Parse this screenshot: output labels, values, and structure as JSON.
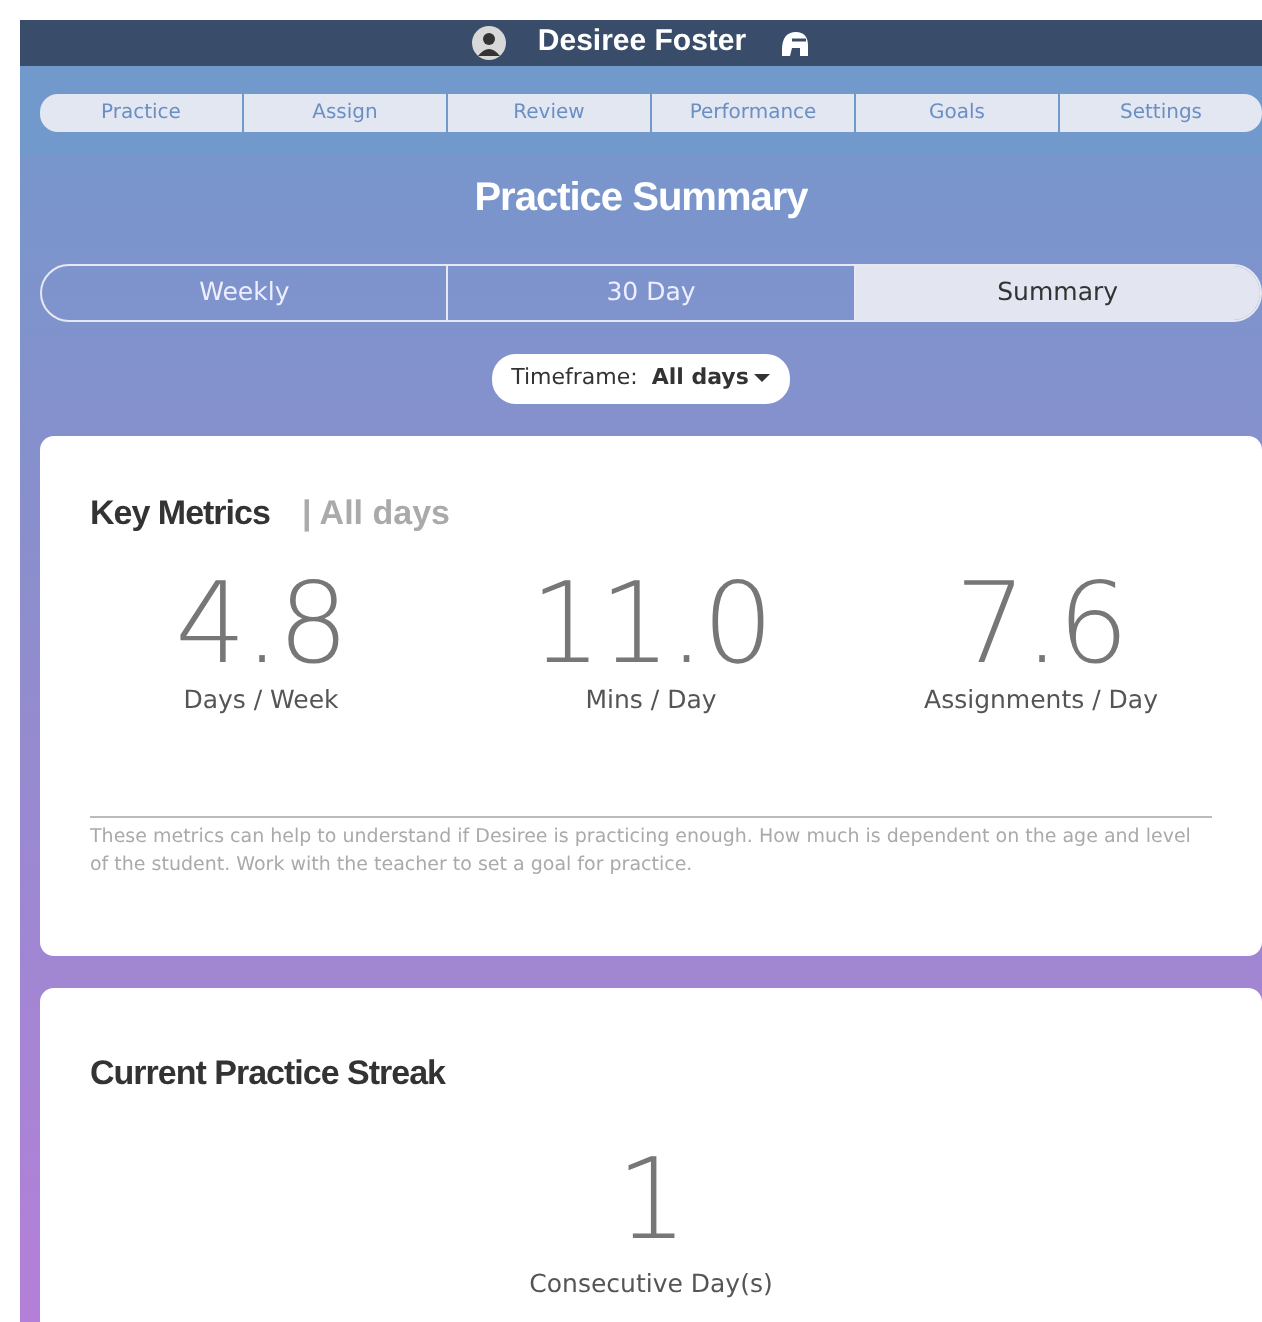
{
  "header": {
    "user_name": "Desiree Foster"
  },
  "nav_tabs": [
    {
      "label": "Practice"
    },
    {
      "label": "Assign"
    },
    {
      "label": "Review"
    },
    {
      "label": "Performance"
    },
    {
      "label": "Goals"
    },
    {
      "label": "Settings"
    }
  ],
  "page_title": "Practice Summary",
  "view_tabs": [
    {
      "label": "Weekly",
      "selected": false
    },
    {
      "label": "30 Day",
      "selected": false
    },
    {
      "label": "Summary",
      "selected": true
    }
  ],
  "timeframe": {
    "label": "Timeframe:",
    "value": "All days"
  },
  "key_metrics": {
    "title": "Key Metrics",
    "separator": "|",
    "subtitle": "All days",
    "metrics": [
      {
        "value": "4.8",
        "label": "Days / Week"
      },
      {
        "value": "11.0",
        "label": "Mins / Day"
      },
      {
        "value": "7.6",
        "label": "Assignments / Day"
      }
    ],
    "note": "These metrics can help to understand if Desiree is practicing enough. How much is dependent on the age and level of the student. Work with the teacher to set a goal for practice."
  },
  "streak": {
    "title": "Current Practice Streak",
    "value": "1",
    "label": "Consecutive Day(s)"
  }
}
